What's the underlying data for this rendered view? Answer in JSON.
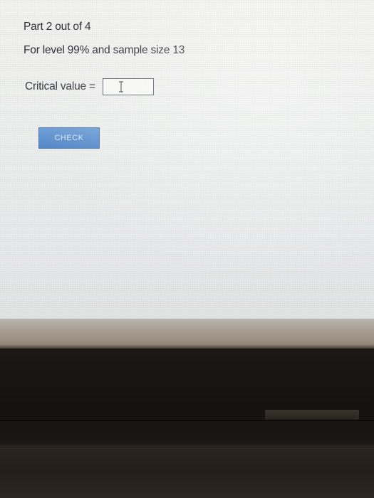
{
  "question": {
    "part_label": "Part 2 out of 4",
    "level_label": "For level 99% and sample size 13"
  },
  "answer": {
    "label": "Critical value = ",
    "value": ""
  },
  "check_button": {
    "label": "CHECK"
  }
}
